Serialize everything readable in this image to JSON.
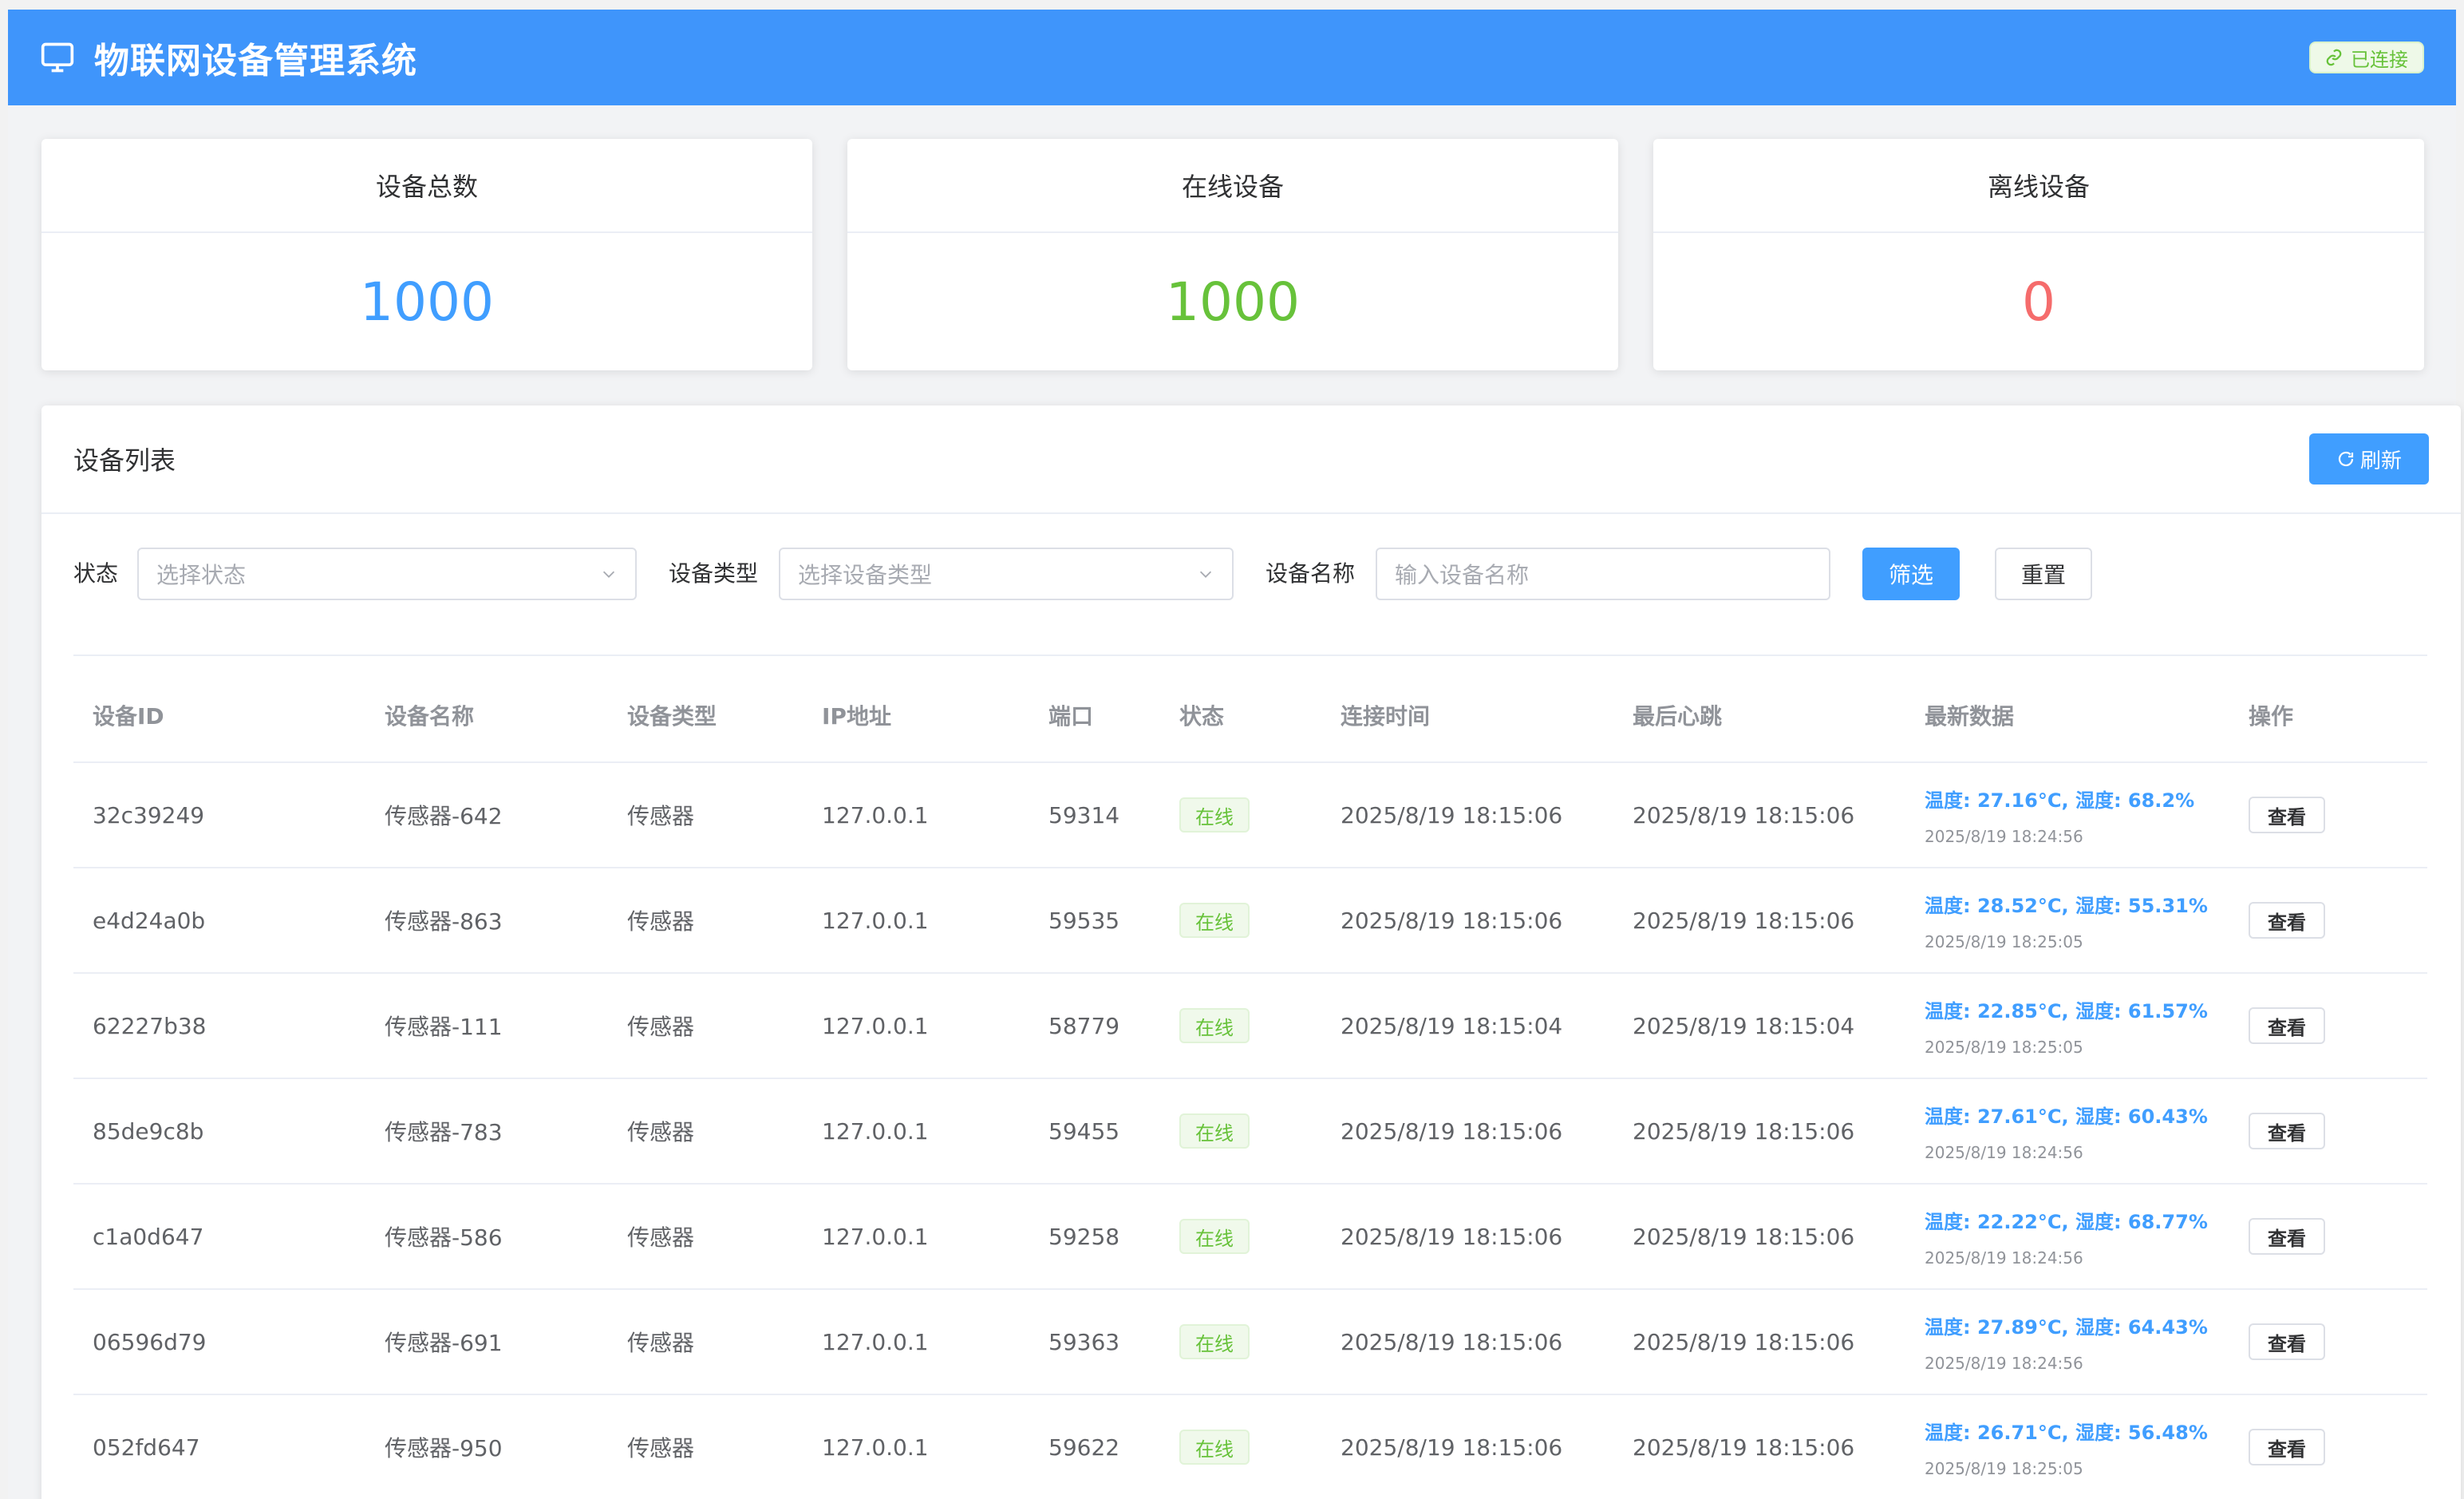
{
  "app": {
    "title": "物联网设备管理系统",
    "connection_status": "已连接",
    "icon": "monitor-icon",
    "brand_color": "#3f95fb"
  },
  "stats": [
    {
      "label": "设备总数",
      "value": "1000",
      "color": "#409eff"
    },
    {
      "label": "在线设备",
      "value": "1000",
      "color": "#67c23a"
    },
    {
      "label": "离线设备",
      "value": "0",
      "color": "#f56c6c"
    }
  ],
  "device_list": {
    "title": "设备列表",
    "refresh_label": "刷新",
    "filters": {
      "status_label": "状态",
      "status_placeholder": "选择状态",
      "type_label": "设备类型",
      "type_placeholder": "选择设备类型",
      "name_label": "设备名称",
      "name_placeholder": "输入设备名称",
      "filter_button": "筛选",
      "reset_button": "重置"
    },
    "columns": [
      "设备ID",
      "设备名称",
      "设备类型",
      "IP地址",
      "端口",
      "状态",
      "连接时间",
      "最后心跳",
      "最新数据",
      "操作"
    ],
    "action_label": "查看",
    "rows": [
      {
        "id": "32c39249",
        "name": "传感器-642",
        "type": "传感器",
        "ip": "127.0.0.1",
        "port": "59314",
        "status": "在线",
        "connected": "2025/8/19 18:15:06",
        "heartbeat": "2025/8/19 18:15:06",
        "data": "温度: 27.16°C, 湿度: 68.2%",
        "data_time": "2025/8/19 18:24:56"
      },
      {
        "id": "e4d24a0b",
        "name": "传感器-863",
        "type": "传感器",
        "ip": "127.0.0.1",
        "port": "59535",
        "status": "在线",
        "connected": "2025/8/19 18:15:06",
        "heartbeat": "2025/8/19 18:15:06",
        "data": "温度: 28.52°C, 湿度: 55.31%",
        "data_time": "2025/8/19 18:25:05"
      },
      {
        "id": "62227b38",
        "name": "传感器-111",
        "type": "传感器",
        "ip": "127.0.0.1",
        "port": "58779",
        "status": "在线",
        "connected": "2025/8/19 18:15:04",
        "heartbeat": "2025/8/19 18:15:04",
        "data": "温度: 22.85°C, 湿度: 61.57%",
        "data_time": "2025/8/19 18:25:05"
      },
      {
        "id": "85de9c8b",
        "name": "传感器-783",
        "type": "传感器",
        "ip": "127.0.0.1",
        "port": "59455",
        "status": "在线",
        "connected": "2025/8/19 18:15:06",
        "heartbeat": "2025/8/19 18:15:06",
        "data": "温度: 27.61°C, 湿度: 60.43%",
        "data_time": "2025/8/19 18:24:56"
      },
      {
        "id": "c1a0d647",
        "name": "传感器-586",
        "type": "传感器",
        "ip": "127.0.0.1",
        "port": "59258",
        "status": "在线",
        "connected": "2025/8/19 18:15:06",
        "heartbeat": "2025/8/19 18:15:06",
        "data": "温度: 22.22°C, 湿度: 68.77%",
        "data_time": "2025/8/19 18:24:56"
      },
      {
        "id": "06596d79",
        "name": "传感器-691",
        "type": "传感器",
        "ip": "127.0.0.1",
        "port": "59363",
        "status": "在线",
        "connected": "2025/8/19 18:15:06",
        "heartbeat": "2025/8/19 18:15:06",
        "data": "温度: 27.89°C, 湿度: 64.43%",
        "data_time": "2025/8/19 18:24:56"
      },
      {
        "id": "052fd647",
        "name": "传感器-950",
        "type": "传感器",
        "ip": "127.0.0.1",
        "port": "59622",
        "status": "在线",
        "connected": "2025/8/19 18:15:06",
        "heartbeat": "2025/8/19 18:15:06",
        "data": "温度: 26.71°C, 湿度: 56.48%",
        "data_time": "2025/8/19 18:25:05"
      }
    ]
  }
}
